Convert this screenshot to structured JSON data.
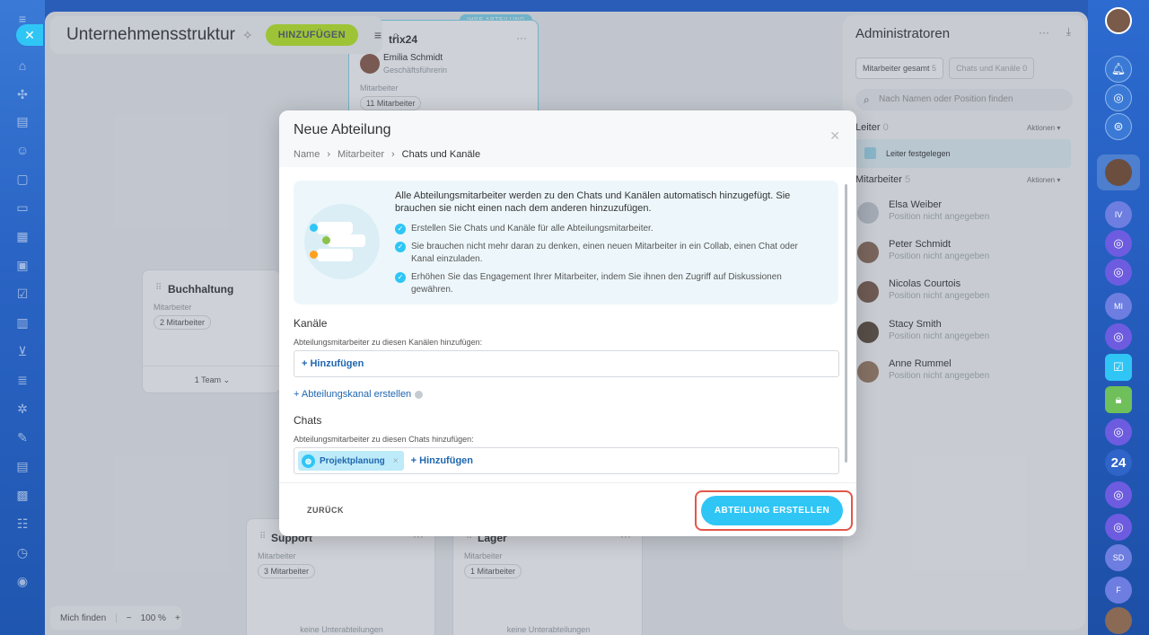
{
  "canvas": {
    "title": "Unternehmensstruktur",
    "add_button": "HINZUFÜGEN",
    "top_card": {
      "badge": "IHRE ABTEILUNG",
      "name": "trix24",
      "head_name": "Emilia Schmidt",
      "head_role": "Geschäftsführerin",
      "staff_label": "Mitarbeiter",
      "staff_count": "11 Mitarbeiter"
    },
    "cards": [
      {
        "name": "Buchhaltung",
        "staff_label": "Mitarbeiter",
        "staff_count": "2 Mitarbeiter",
        "footer": "1 Team"
      },
      {
        "name": "Support",
        "staff_label": "Mitarbeiter",
        "staff_count": "3 Mitarbeiter",
        "footer": "keine Unterabteilungen"
      },
      {
        "name": "Lager",
        "staff_label": "Mitarbeiter",
        "staff_count": "1 Mitarbeiter",
        "footer": "keine Unterabteilungen"
      }
    ],
    "bottom": {
      "find_me": "Mich finden",
      "zoom": "100 %",
      "minus": "−",
      "plus": "+"
    }
  },
  "admin": {
    "title": "Administratoren",
    "tab_staff": "Mitarbeiter gesamt",
    "tab_staff_count": "5",
    "tab_chats": "Chats und Kanäle",
    "tab_chats_count": "0",
    "search_placeholder": "Nach Namen oder Position finden",
    "leader_label": "Leiter",
    "leader_count": "0",
    "actions": "Aktionen",
    "leader_set": "Leiter festgelegen",
    "staff_label": "Mitarbeiter",
    "staff_count": "5",
    "people": [
      {
        "name": "Elsa Weiber",
        "position": "Position nicht angegeben",
        "color": "#c5cad0"
      },
      {
        "name": "Peter Schmidt",
        "position": "Position nicht angegeben",
        "color": "#8a6a55"
      },
      {
        "name": "Nicolas Courtois",
        "position": "Position nicht angegeben",
        "color": "#7a5a48"
      },
      {
        "name": "Stacy Smith",
        "position": "Position nicht angegeben",
        "color": "#5a4a3a"
      },
      {
        "name": "Anne Rummel",
        "position": "Position nicht angegeben",
        "color": "#9a7a60"
      }
    ]
  },
  "modal": {
    "title": "Neue Abteilung",
    "breadcrumbs": [
      "Name",
      "Mitarbeiter",
      "Chats und Kanäle"
    ],
    "info_head": "Alle Abteilungsmitarbeiter werden zu den Chats und Kanälen automatisch hinzugefügt. Sie brauchen sie nicht einen nach dem anderen hinzuzufügen.",
    "info_items": [
      "Erstellen Sie Chats und Kanäle für alle Abteilungsmitarbeiter.",
      "Sie brauchen nicht mehr daran zu denken, einen neuen Mitarbeiter in ein Collab, einen Chat oder Kanal einzuladen.",
      "Erhöhen Sie das Engagement Ihrer Mitarbeiter, indem Sie ihnen den Zugriff auf Diskussionen gewähren."
    ],
    "channels_title": "Kanäle",
    "channels_sub": "Abteilungsmitarbeiter zu diesen Kanälen hinzufügen:",
    "add_link": "+ Hinzufügen",
    "create_channel": "+ Abteilungskanal erstellen",
    "chats_title": "Chats",
    "chats_sub": "Abteilungsmitarbeiter zu diesen Chats hinzufügen:",
    "chat_chip": "Projektplanung",
    "back": "ZURÜCK",
    "create": "ABTEILUNG ERSTELLEN"
  },
  "colors": {
    "accent": "#2fc6f6",
    "link": "#2067b0",
    "add_green": "#bbed21",
    "highlight": "#e2574a"
  },
  "right_bar": {
    "counter": "24",
    "initials": [
      "IV",
      "MI",
      "SD",
      "F"
    ]
  }
}
